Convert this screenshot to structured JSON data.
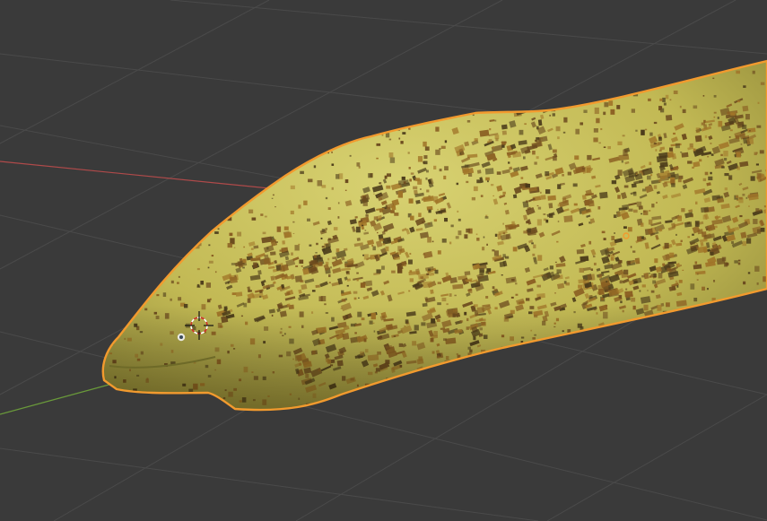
{
  "viewport": {
    "background_color": "#3a3a3a",
    "grid_line_color": "#4a4a4a",
    "x_axis_color": "#b04a4a",
    "y_axis_color": "#6a9a3a"
  },
  "scene": {
    "object": {
      "type": "mesh",
      "shape": "moray-eel",
      "selected": true,
      "selection_outline_color": "#f29a2e",
      "base_color": "#c8c05a",
      "spot_colors": [
        "#6b4a1e",
        "#8a5e22",
        "#4a3a1a",
        "#a07428"
      ]
    },
    "cursor_3d": {
      "icon": "crosshair-cursor-icon"
    },
    "origin": {
      "icon": "object-origin-icon"
    }
  }
}
